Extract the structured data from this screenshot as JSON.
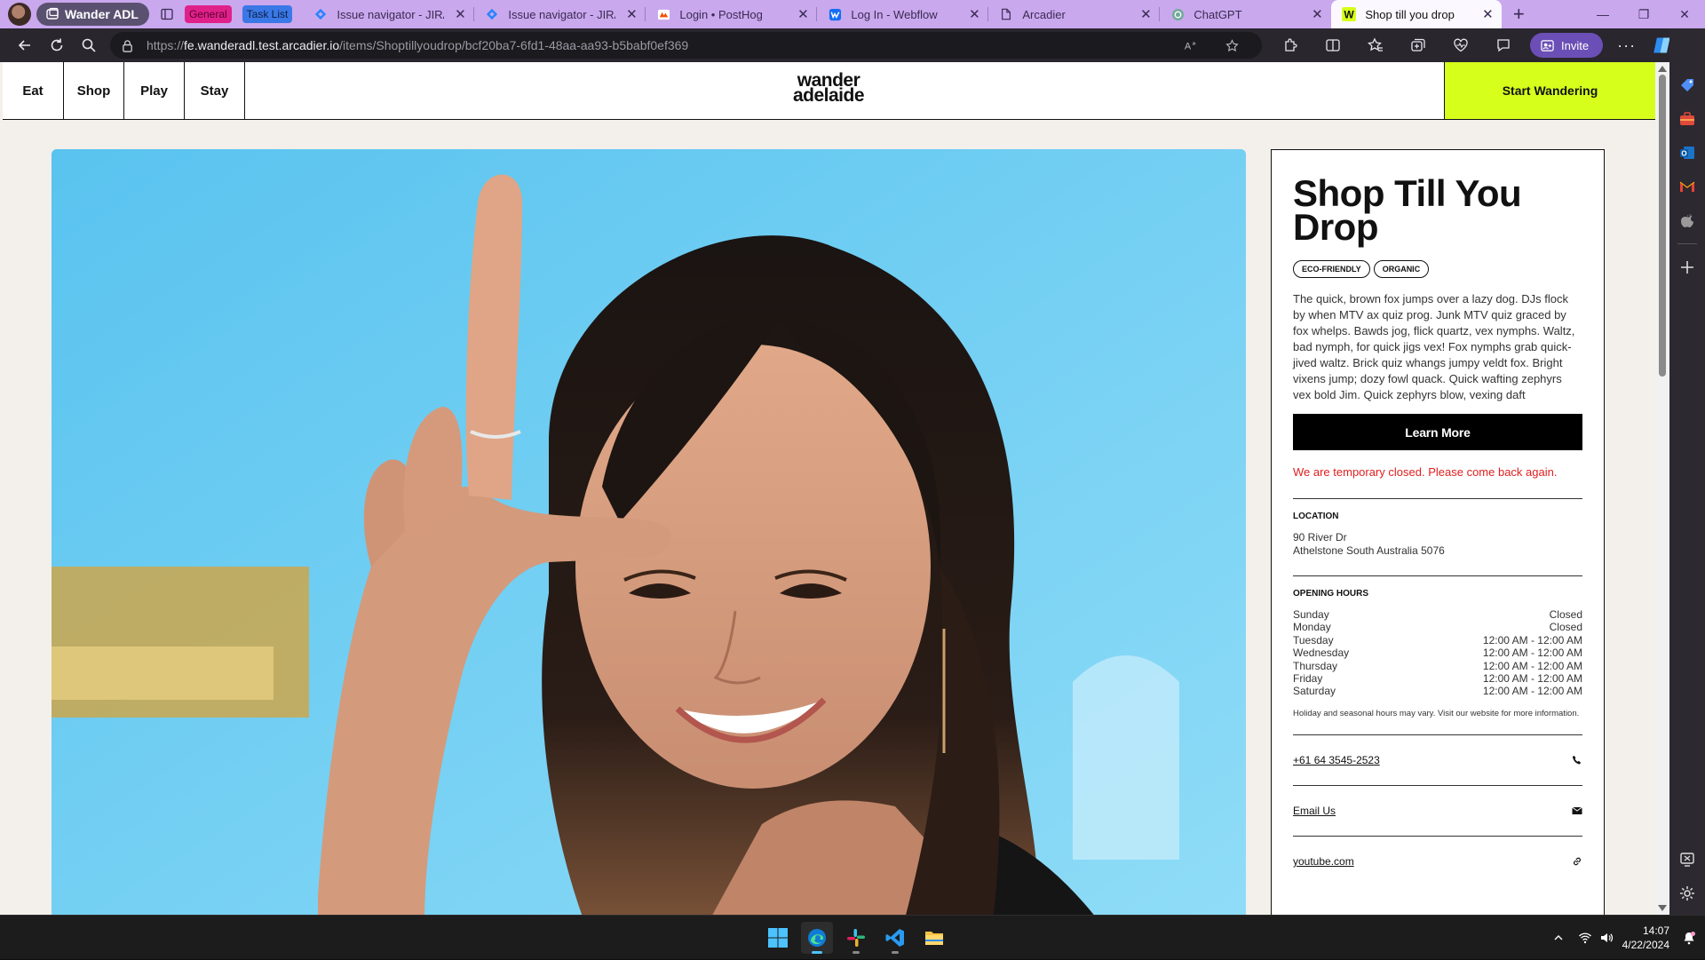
{
  "browser": {
    "workspace": "Wander ADL",
    "tab_groups": [
      {
        "label": "General",
        "color": "#e0218a",
        "text_color": "#5a0030"
      },
      {
        "label": "Task List",
        "color": "#3b78e7",
        "text_color": "#0a1f44"
      }
    ],
    "tabs": [
      {
        "title": "Issue navigator - JIRA",
        "icon": "jira-icon"
      },
      {
        "title": "Issue navigator - JIRA",
        "icon": "jira-icon"
      },
      {
        "title": "Login • PostHog",
        "icon": "posthog-icon"
      },
      {
        "title": "Log In - Webflow",
        "icon": "webflow-icon"
      },
      {
        "title": "Arcadier",
        "icon": "page-icon"
      },
      {
        "title": "ChatGPT",
        "icon": "chatgpt-icon"
      },
      {
        "title": "Shop till you drop",
        "icon": "wander-icon",
        "active": true
      }
    ],
    "url_prefix": "https://",
    "url_host": "fe.wanderadl.test.arcadier.io",
    "url_path": "/items/Shoptillyoudrop/bcf20ba7-6fd1-48aa-aa93-b5babf0ef369",
    "invite_label": "Invite"
  },
  "site": {
    "nav": [
      "Eat",
      "Shop",
      "Play",
      "Stay"
    ],
    "logo_line1": "wander",
    "logo_line2": "adelaide",
    "cta": "Start Wandering",
    "cta_color": "#d6ff1c"
  },
  "listing": {
    "title": "Shop Till You Drop",
    "tags": [
      "ECO-FRIENDLY",
      "ORGANIC"
    ],
    "description": "The quick, brown fox jumps over a lazy dog. DJs flock by when MTV ax quiz prog. Junk MTV quiz graced by fox whelps. Bawds jog, flick quartz, vex nymphs. Waltz, bad nymph, for quick jigs vex! Fox nymphs grab quick-jived waltz. Brick quiz whangs jumpy veldt fox. Bright vixens jump; dozy fowl quack. Quick wafting zephyrs vex bold Jim. Quick zephyrs blow, vexing daft",
    "learn_more": "Learn More",
    "closed_notice": "We are temporary closed. Please come back again.",
    "location_heading": "LOCATION",
    "address_line1": "90 River Dr",
    "address_line2": "Athelstone South Australia 5076",
    "hours_heading": "OPENING HOURS",
    "hours": [
      {
        "day": "Sunday",
        "time": "Closed"
      },
      {
        "day": "Monday",
        "time": "Closed"
      },
      {
        "day": "Tuesday",
        "time": "12:00 AM - 12:00 AM"
      },
      {
        "day": "Wednesday",
        "time": "12:00 AM - 12:00 AM"
      },
      {
        "day": "Thursday",
        "time": "12:00 AM - 12:00 AM"
      },
      {
        "day": "Friday",
        "time": "12:00 AM - 12:00 AM"
      },
      {
        "day": "Saturday",
        "time": "12:00 AM - 12:00 AM"
      }
    ],
    "hours_note": "Holiday and seasonal hours may vary. Visit our website for more information.",
    "phone": "+61 64 3545-2523",
    "email_label": "Email Us",
    "website": "youtube.com"
  },
  "taskbar": {
    "time": "14:07",
    "date": "4/22/2024"
  }
}
